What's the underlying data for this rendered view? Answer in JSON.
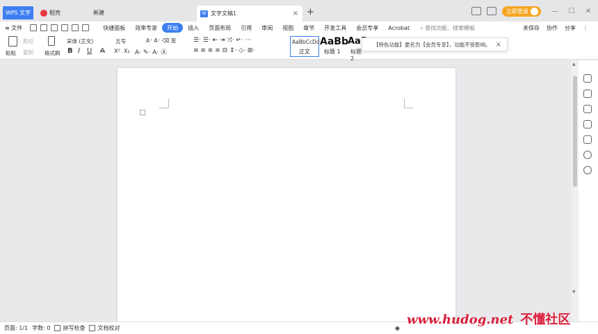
{
  "titlebar": {
    "wps_tab": "WPS 文字",
    "daoke_tab": "稻壳",
    "new_tab": "新建",
    "doc_tab": "文字文稿1",
    "doc_tab_close": "×",
    "add_tab": "+",
    "login_button": "立即登录",
    "minimize": "—",
    "maximize": "☐",
    "close": "✕"
  },
  "menubar": {
    "menu_toggle": "≡ 文件",
    "items": [
      "快捷面板",
      "效率专家",
      "开始",
      "插入",
      "页面布局",
      "引用",
      "审阅",
      "视图",
      "章节",
      "开发工具",
      "会员专享",
      "Acrobat"
    ],
    "active_index": 2,
    "search_placeholder": "查找功能、搜索模板",
    "unsaved": "未保存",
    "collaborate": "协作",
    "share": "分享",
    "more": "⋮"
  },
  "ribbon": {
    "paste": "粘贴",
    "cut": "剪切",
    "copy": "复制",
    "format_painter": "格式刷",
    "font_name": "宋体 (正文)",
    "font_size": "五号",
    "bold": "B",
    "italic": "I",
    "underline": "U",
    "strike": "A",
    "superscript": "X²",
    "subscript": "X₂",
    "styles": [
      {
        "sample": "AaBbCcDd",
        "label": "正文"
      },
      {
        "sample": "AaBb",
        "label": "标题 1"
      },
      {
        "sample": "AaB",
        "label": "标题 2"
      }
    ],
    "notice": "【特色功能】更名为【会员专享】，功能不受影响。",
    "notice_close": "×"
  },
  "statusbar": {
    "page": "页面: 1/1",
    "words": "字数: 0",
    "spell_check": "拼写检查",
    "doc_check": "文档校对"
  },
  "watermark": {
    "domain": "www.hudog.net",
    "name": "不懂社区"
  },
  "colors": {
    "accent": "#3d7ef0",
    "login": "#f6a623",
    "watermark": "#d81e3a"
  }
}
